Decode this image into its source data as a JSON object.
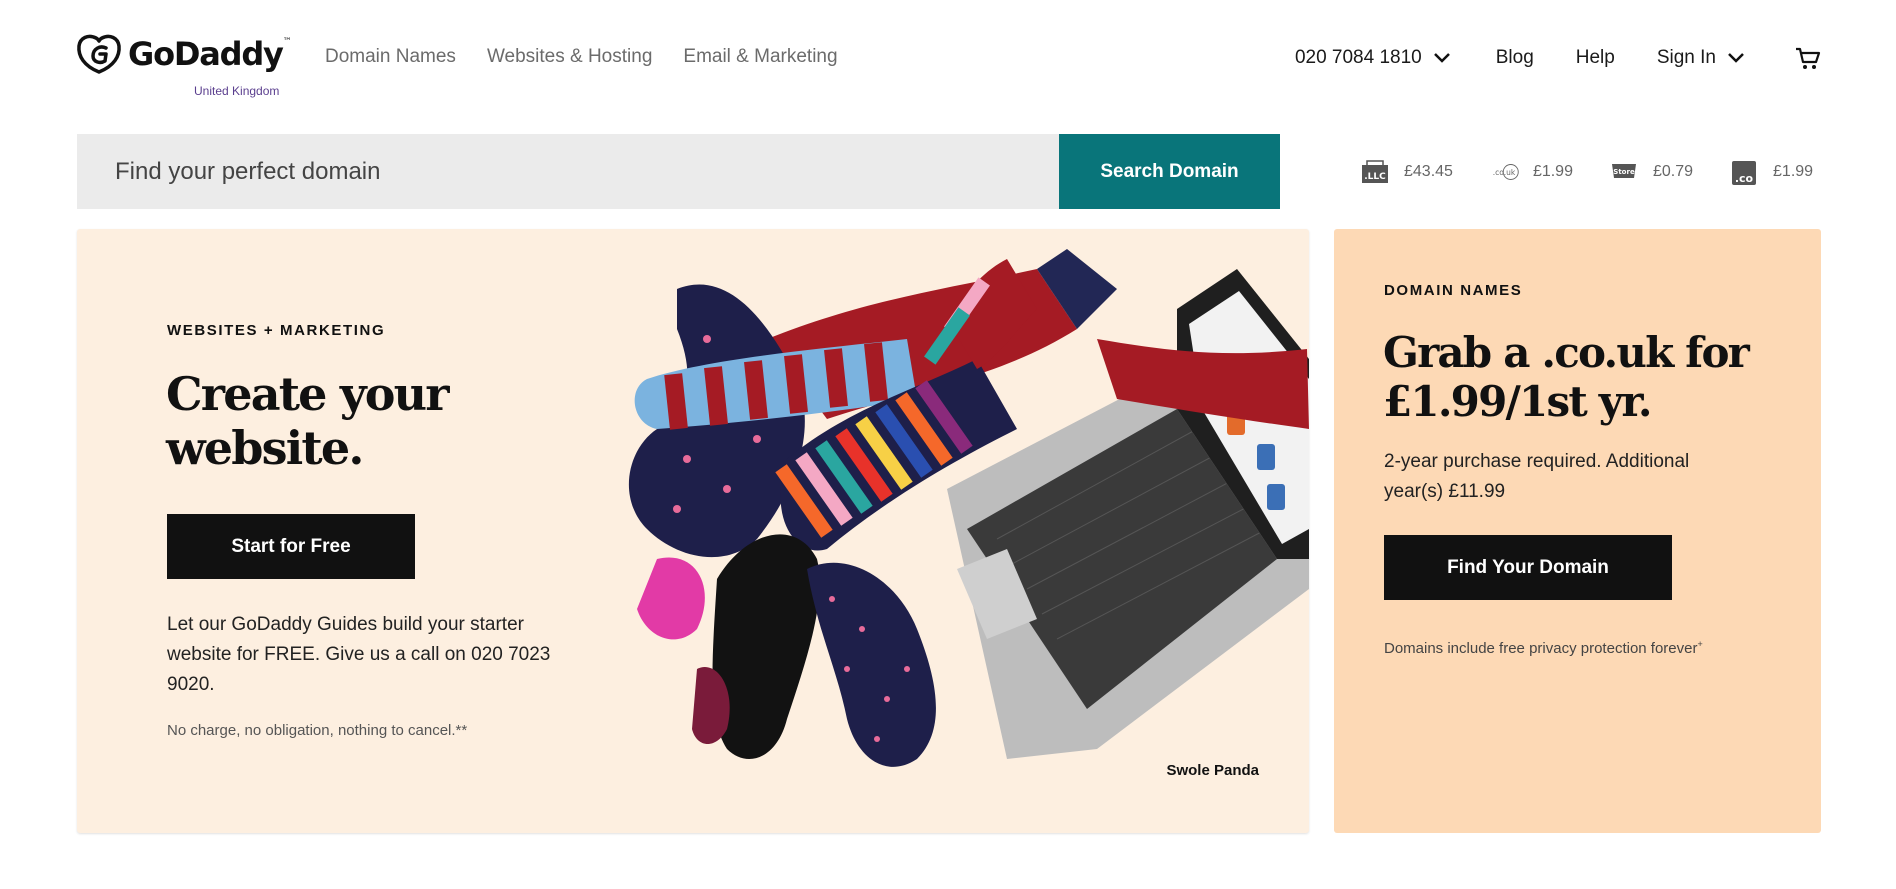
{
  "brand": {
    "name": "GoDaddy",
    "tm": "™",
    "region": "United Kingdom"
  },
  "nav": {
    "items": [
      "Domain Names",
      "Websites & Hosting",
      "Email & Marketing"
    ]
  },
  "utility_nav": {
    "phone": "020 7084 1810",
    "blog": "Blog",
    "help": "Help",
    "sign_in": "Sign In"
  },
  "search": {
    "placeholder": "Find your perfect domain",
    "button_label": "Search Domain"
  },
  "tlds": [
    {
      "icon": "llc-tld-icon",
      "ext": ".LLC",
      "price": "£43.45"
    },
    {
      "icon": "couk-tld-icon",
      "ext": ".co.uk",
      "price": "£1.99"
    },
    {
      "icon": "store-tld-icon",
      "ext": "Store",
      "price": "£0.79"
    },
    {
      "icon": "co-tld-icon",
      "ext": ".co",
      "price": "£1.99"
    }
  ],
  "hero": {
    "eyebrow": "WEBSITES + MARKETING",
    "title": "Create your website.",
    "cta_label": "Start for Free",
    "body": "Let our GoDaddy Guides build your starter website for FREE. Give us a call on 020 7023 9020.",
    "fine_print": "No charge, no obligation, nothing to cancel.**",
    "image_caption": "Swole Panda"
  },
  "domain_card": {
    "eyebrow": "DOMAIN NAMES",
    "title": "Grab a .co.uk for £1.99/1st yr.",
    "body": "2-year purchase required. Additional year(s) £11.99",
    "cta_label": "Find Your Domain",
    "fine_print": "Domains include free privacy protection forever",
    "fine_print_mark": "+"
  },
  "colors": {
    "accent_teal": "#09757a",
    "hero_bg": "#fdefe0",
    "domain_card_bg": "#fdd9b5",
    "button_dark": "#111111"
  }
}
